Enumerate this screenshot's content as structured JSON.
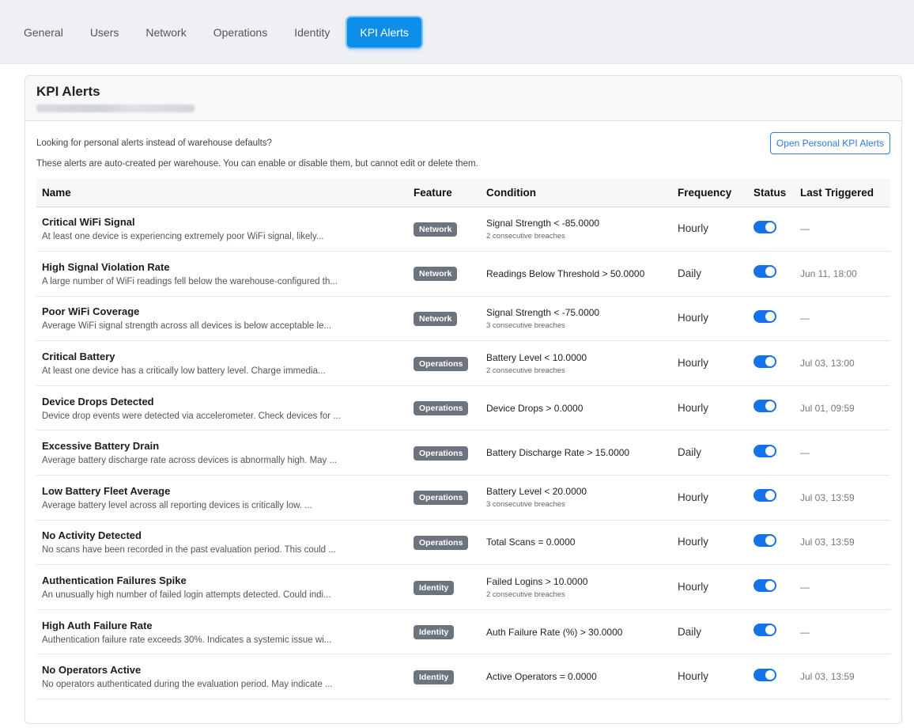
{
  "tabs": [
    {
      "label": "General"
    },
    {
      "label": "Users"
    },
    {
      "label": "Network"
    },
    {
      "label": "Operations"
    },
    {
      "label": "Identity"
    },
    {
      "label": "KPI Alerts",
      "active": true
    }
  ],
  "card": {
    "title": "KPI Alerts",
    "intro_text": "Looking for personal alerts instead of warehouse defaults?",
    "personal_button": "Open Personal KPI Alerts",
    "auto_note": "These alerts are auto-created per warehouse. You can enable or disable them, but cannot edit or delete them."
  },
  "table": {
    "headers": [
      "Name",
      "Feature",
      "Condition",
      "Frequency",
      "Status",
      "Last Triggered"
    ],
    "rows": [
      {
        "name": "Critical WiFi Signal",
        "desc": "At least one device is experiencing extremely poor WiFi signal, likely...",
        "feature": "Network",
        "condition": "Signal Strength < -85.0000",
        "breaches": "2 consecutive breaches",
        "frequency": "Hourly",
        "enabled": true,
        "last": "—"
      },
      {
        "name": "High Signal Violation Rate",
        "desc": "A large number of WiFi readings fell below the warehouse-configured th...",
        "feature": "Network",
        "condition": "Readings Below Threshold > 50.0000",
        "breaches": "",
        "frequency": "Daily",
        "enabled": true,
        "last": "Jun 11, 18:00"
      },
      {
        "name": "Poor WiFi Coverage",
        "desc": "Average WiFi signal strength across all devices is below acceptable le...",
        "feature": "Network",
        "condition": "Signal Strength < -75.0000",
        "breaches": "3 consecutive breaches",
        "frequency": "Hourly",
        "enabled": true,
        "last": "—"
      },
      {
        "name": "Critical Battery",
        "desc": "At least one device has a critically low battery level. Charge immedia...",
        "feature": "Operations",
        "condition": "Battery Level < 10.0000",
        "breaches": "2 consecutive breaches",
        "frequency": "Hourly",
        "enabled": true,
        "last": "Jul 03, 13:00"
      },
      {
        "name": "Device Drops Detected",
        "desc": "Device drop events were detected via accelerometer. Check devices for ...",
        "feature": "Operations",
        "condition": "Device Drops > 0.0000",
        "breaches": "",
        "frequency": "Hourly",
        "enabled": true,
        "last": "Jul 01, 09:59"
      },
      {
        "name": "Excessive Battery Drain",
        "desc": "Average battery discharge rate across devices is abnormally high. May ...",
        "feature": "Operations",
        "condition": "Battery Discharge Rate > 15.0000",
        "breaches": "",
        "frequency": "Daily",
        "enabled": true,
        "last": "—"
      },
      {
        "name": "Low Battery Fleet Average",
        "desc": "Average battery level across all reporting devices is critically low. ...",
        "feature": "Operations",
        "condition": "Battery Level < 20.0000",
        "breaches": "3 consecutive breaches",
        "frequency": "Hourly",
        "enabled": true,
        "last": "Jul 03, 13:59"
      },
      {
        "name": "No Activity Detected",
        "desc": "No scans have been recorded in the past evaluation period. This could ...",
        "feature": "Operations",
        "condition": "Total Scans = 0.0000",
        "breaches": "",
        "frequency": "Hourly",
        "enabled": true,
        "last": "Jul 03, 13:59"
      },
      {
        "name": "Authentication Failures Spike",
        "desc": "An unusually high number of failed login attempts detected. Could indi...",
        "feature": "Identity",
        "condition": "Failed Logins > 10.0000",
        "breaches": "2 consecutive breaches",
        "frequency": "Hourly",
        "enabled": true,
        "last": "—"
      },
      {
        "name": "High Auth Failure Rate",
        "desc": "Authentication failure rate exceeds 30%. Indicates a systemic issue wi...",
        "feature": "Identity",
        "condition": "Auth Failure Rate (%) > 30.0000",
        "breaches": "",
        "frequency": "Daily",
        "enabled": true,
        "last": "—"
      },
      {
        "name": "No Operators Active",
        "desc": "No operators authenticated during the evaluation period. May indicate ...",
        "feature": "Identity",
        "condition": "Active Operators = 0.0000",
        "breaches": "",
        "frequency": "Hourly",
        "enabled": true,
        "last": "Jul 03, 13:59"
      }
    ]
  }
}
